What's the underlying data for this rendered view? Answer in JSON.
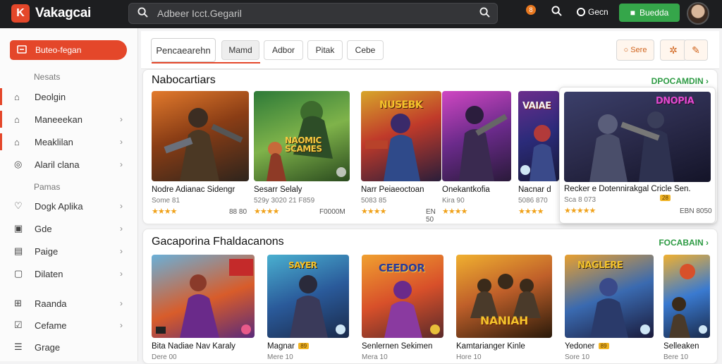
{
  "topbar": {
    "logo_letter": "K",
    "logo_text": "Vakagcai",
    "search_placeholder": "Adbeer Icct.Gegaril",
    "search_icon": "search-icon",
    "notif_count": "8",
    "signin_label": "Gecn",
    "cta_label": "Buedda"
  },
  "sidebar": {
    "cta_label": "Buteo-fegan",
    "section1": "Nesats",
    "section2": "Pamas",
    "items": [
      {
        "label": "Deolgin",
        "icon": "home-icon",
        "chevron": false
      },
      {
        "label": "Maneeekan",
        "icon": "controller-icon",
        "chevron": true
      },
      {
        "label": "Meaklilan",
        "icon": "controller-icon",
        "chevron": true
      },
      {
        "label": "Alaril clana",
        "icon": "info-icon",
        "chevron": true
      },
      {
        "label": "Dogk Aplika",
        "icon": "heart-icon",
        "chevron": true
      },
      {
        "label": "Gde",
        "icon": "box-icon",
        "chevron": true
      },
      {
        "label": "Paige",
        "icon": "page-icon",
        "chevron": true
      },
      {
        "label": "Dilaten",
        "icon": "folder-icon",
        "chevron": true
      },
      {
        "label": "Raanda",
        "icon": "grid-icon",
        "chevron": true
      },
      {
        "label": "Cefame",
        "icon": "check-icon",
        "chevron": true
      },
      {
        "label": "Grage",
        "icon": "list-icon",
        "chevron": false
      }
    ]
  },
  "tabs": [
    "Pencaearehn",
    "Mamd",
    "Adbor",
    "Pitak",
    "Cebe"
  ],
  "tools": {
    "sort_label": "Sere"
  },
  "section1": {
    "title": "Nabocartiars",
    "link": "DPOCAMDIN",
    "cards": [
      {
        "title": "Nodre Adianac Sidengr",
        "meta": "Some 81",
        "right": "88 80",
        "art": "",
        "stars": "★★★★"
      },
      {
        "title": "Sesarr Selaly",
        "meta": "529y 3020 21 F859",
        "right": "F0000M",
        "art": "NAOMIC SCAMES",
        "stars": "★★★★"
      },
      {
        "title": "Narr Peiaeoctoan",
        "meta": "5083 85",
        "right": "EN 50",
        "art": "NUSEBK",
        "stars": "★★★★"
      },
      {
        "title": "Onekantkofia",
        "meta": "Kira 90",
        "right": "",
        "art": "",
        "stars": "★★★★"
      },
      {
        "title": "Nacnar d",
        "meta": "5086 870",
        "right": "",
        "art": "VAIAE",
        "stars": "★★★★"
      },
      {
        "title": "Recker e Dotennirakgal Cricle Sen.",
        "meta": "Sca 8 073",
        "right": "EBN 8050",
        "art": "DNOPIA",
        "badge": "28",
        "stars": "★★★★★"
      }
    ]
  },
  "section2": {
    "title": "Gacaporina Fhaldacanons",
    "link": "FOCABAIN",
    "cards": [
      {
        "title": "Bita Nadiae Nav Karaly",
        "meta": "Dere 00",
        "art": "",
        "badge": ""
      },
      {
        "title": "Magnar",
        "meta": "Mere 10",
        "art": "SAYER",
        "badge": "89"
      },
      {
        "title": "Senlernen Sekimen",
        "meta": "Mera 10",
        "art": "CEEDOR",
        "badge": ""
      },
      {
        "title": "Kamtarianger Kinle",
        "meta": "Hore 10",
        "art": "NANIAH",
        "badge": ""
      },
      {
        "title": "Yedoner",
        "meta": "Sore 10",
        "art": "NAGLERE",
        "badge": "89"
      },
      {
        "title": "Selleaken",
        "meta": "Bere 10",
        "art": "",
        "badge": ""
      }
    ]
  },
  "colors": {
    "accent": "#e4472a",
    "green": "#35a64a",
    "topbar": "#1d1e20"
  }
}
